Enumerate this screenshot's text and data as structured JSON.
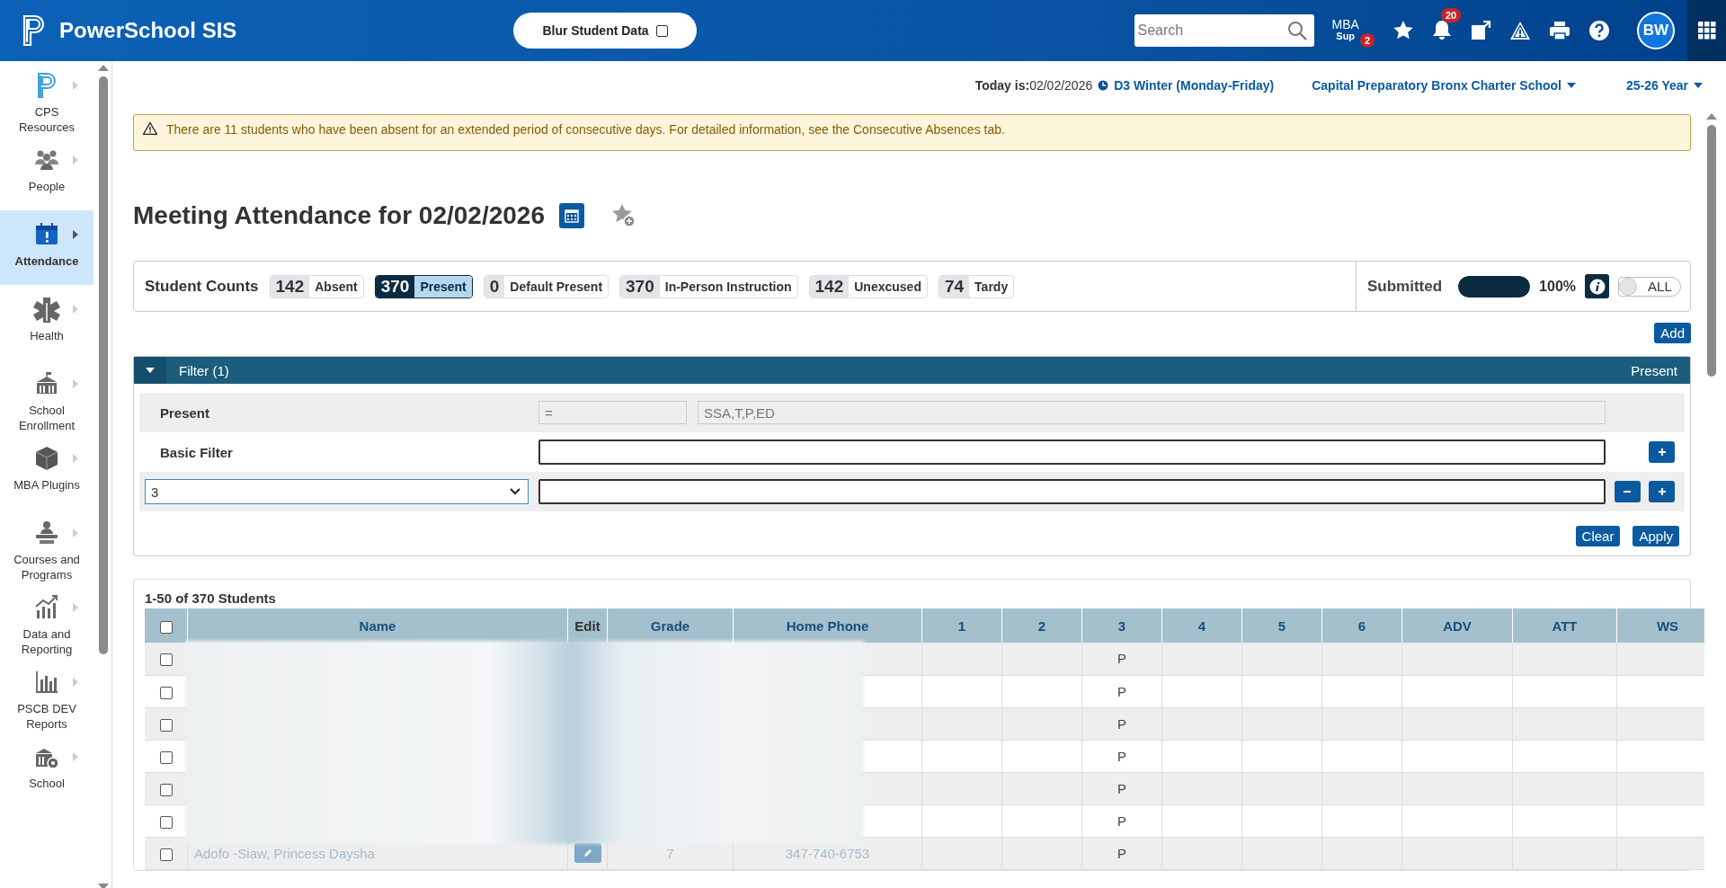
{
  "topbar": {
    "product": "PowerSchool SIS",
    "blur_toggle": {
      "label": "Blur Student Data",
      "checked": false
    },
    "search": {
      "placeholder": "Search"
    },
    "mba": {
      "line1": "MBA",
      "line2": "Sup",
      "badge": "2"
    },
    "notifications_badge": "20",
    "avatar": "BW"
  },
  "sidebar": {
    "items": [
      {
        "kind": "logo",
        "label": "CPS Resources",
        "selected": false
      },
      {
        "kind": "people",
        "label": "People",
        "selected": false
      },
      {
        "kind": "calendar",
        "label": "Attendance",
        "selected": true
      },
      {
        "kind": "medical",
        "label": "Health",
        "selected": false
      },
      {
        "kind": "building",
        "label": "School Enrollment",
        "selected": false
      },
      {
        "kind": "cube",
        "label": "MBA Plugins",
        "selected": false
      },
      {
        "kind": "presenter",
        "label": "Courses and Programs",
        "selected": false
      },
      {
        "kind": "chart-up",
        "label": "Data and Reporting",
        "selected": false
      },
      {
        "kind": "bar-chart",
        "label": "PSCB DEV Reports",
        "selected": false
      },
      {
        "kind": "building-gear",
        "label": "School",
        "selected": false
      }
    ]
  },
  "context_bar": {
    "today_label": "Today is:",
    "date": "02/02/2026",
    "term": "D3 Winter (Monday-Friday)",
    "school": "Capital Preparatory Bronx Charter School",
    "year": "25-26 Year"
  },
  "alert": {
    "text": "There are 11 students who have been absent for an extended period of consecutive days. For detailed information, see the Consecutive Absences tab."
  },
  "page_title": "Meeting Attendance for 02/02/2026",
  "student_counts": {
    "label": "Student Counts",
    "counts": [
      {
        "count": "142",
        "label": "Absent",
        "selected": false
      },
      {
        "count": "370",
        "label": "Present",
        "selected": true
      },
      {
        "count": "0",
        "label": "Default Present",
        "selected": false
      },
      {
        "count": "370",
        "label": "In-Person Instruction",
        "selected": false
      },
      {
        "count": "142",
        "label": "Unexcused",
        "selected": false
      },
      {
        "count": "74",
        "label": "Tardy",
        "selected": false
      }
    ],
    "submitted": {
      "label": "Submitted",
      "level": 1,
      "reading": "100%"
    },
    "all_toggle": {
      "label": "ALL",
      "on": false
    }
  },
  "add_button": "Add",
  "filter": {
    "title": "Filter (1)",
    "expanded": true,
    "summary": "Present",
    "rows": [
      {
        "kind": "fixed",
        "label": "Present",
        "operator": "=",
        "value": "SSA,T,P,ED"
      },
      {
        "kind": "basic",
        "label": "Basic Filter"
      },
      {
        "kind": "select",
        "value": "3"
      }
    ],
    "buttons": [
      "Clear",
      "Apply"
    ]
  },
  "students": {
    "caption": "1-50 of 370 Students",
    "columns": [
      "Name",
      "Edit",
      "Grade",
      "Home Phone",
      "1",
      "2",
      "3",
      "4",
      "5",
      "6",
      "ADV",
      "ATT",
      "WS"
    ],
    "rows": [
      {
        "checked": false,
        "blurred": true,
        "period_3": "P"
      },
      {
        "checked": false,
        "blurred": true,
        "period_3": "P"
      },
      {
        "checked": false,
        "blurred": true,
        "period_3": "P"
      },
      {
        "checked": false,
        "blurred": true,
        "period_3": "P"
      },
      {
        "checked": false,
        "blurred": true,
        "period_3": "P"
      },
      {
        "checked": false,
        "blurred": true,
        "period_3": "P"
      },
      {
        "checked": false,
        "blurred": false,
        "name": "Adofo -Siaw, Princess Daysha",
        "grade": "7",
        "home_phone": "347-740-6753",
        "period_3": "P"
      }
    ],
    "all_checked": false
  }
}
